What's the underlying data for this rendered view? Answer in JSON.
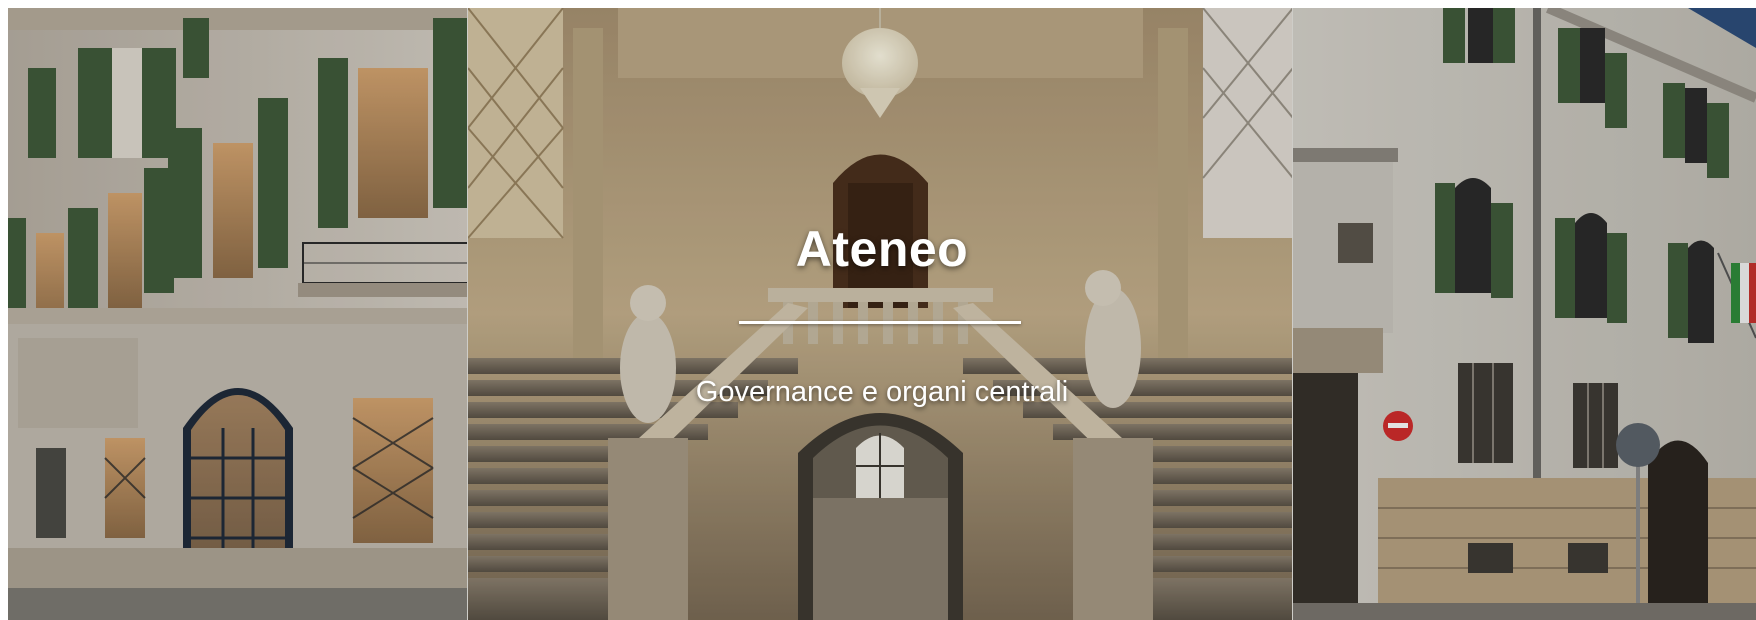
{
  "hero": {
    "title": "Ateneo",
    "subtitle": "Governance e organi centrali",
    "images": [
      {
        "name": "building-facade-left"
      },
      {
        "name": "staircase-interior"
      },
      {
        "name": "building-facade-right"
      }
    ],
    "colors": {
      "text": "#ffffff",
      "facade": "#cfc9bf",
      "shutters": "#3f5a3a",
      "stone": "#b8a68a",
      "interior": "#c9b48e"
    }
  }
}
